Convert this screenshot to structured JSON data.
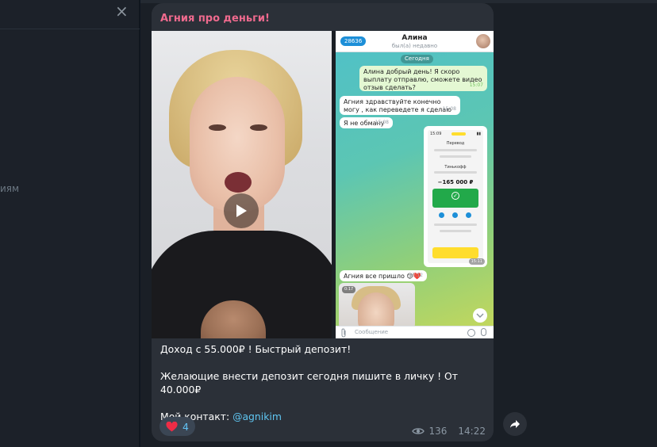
{
  "left_panel": {
    "close_glyph": "×",
    "partial_text": "иям"
  },
  "message": {
    "channel_name": "Агния про деньги!",
    "caption": {
      "line1": "Доход с 55.000₽ ! Быстрый депозит!",
      "line2": "Желающие внести депозит сегодня пишите в личку ! От 40.000₽",
      "line3_prefix": "Мой контакт: ",
      "line3_mention": "@agnikim"
    },
    "reaction": {
      "icon": "heart-icon",
      "count": "4"
    },
    "views": "136",
    "time": "14:22"
  },
  "screenshot": {
    "back_count": "28636",
    "chat_title": "Алина",
    "chat_subtitle": "был(а) недавно",
    "date_chip": "Сегодня",
    "messages": [
      {
        "side": "out",
        "text": "Алина добрый день! Я скоро выплату отправлю, сможете видео отзыв сделать?",
        "time": "15:07"
      },
      {
        "side": "in",
        "text": "Агния здравствуйте конечно могу , как переведете я сделаю",
        "time": "15:08"
      },
      {
        "side": "in",
        "text": "Я не обману",
        "time": "15:08"
      },
      {
        "side": "in",
        "text": "Агния все пришло 😊❤️",
        "time": "15:12"
      }
    ],
    "receipt": {
      "status_time": "15:09",
      "title": "Перевод",
      "bank": "Тинькофф",
      "amount": "−165 000 ₽",
      "time": "15:11"
    },
    "video_duration": "0:17",
    "input_placeholder": "Сообщение"
  }
}
